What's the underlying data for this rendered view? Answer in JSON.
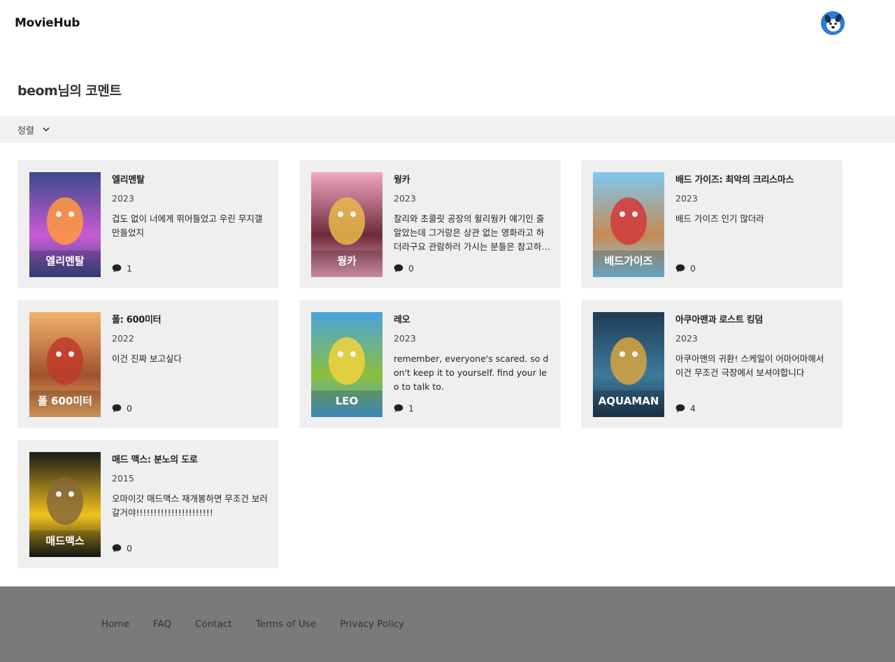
{
  "header": {
    "logo": "MovieHub",
    "avatar_icon": "dog-avatar-icon"
  },
  "page": {
    "title": "beom님의 코멘트"
  },
  "sort": {
    "label": "정렬",
    "icon": "chevron-down-icon"
  },
  "comments": [
    {
      "title": "엘리멘탈",
      "year": "2023",
      "text": "겁도 없이 너에게 뛰어들었고 우린 무지갤 만들었지",
      "comment_count": "1",
      "poster_caption": "엘리멘탈",
      "poster_colors": [
        "#3a4a8a",
        "#c95bd6",
        "#ff9a3c"
      ]
    },
    {
      "title": "웡카",
      "year": "2023",
      "text": "찰리와 초콜릿 공장의 윌리웡카 얘기인 줄 알았는데 그거랑은 상관 없는 영화라고 하더라구요 관람하러 가시는 분들은 참고하세요",
      "comment_count": "0",
      "poster_caption": "웡카",
      "poster_colors": [
        "#f2a7c3",
        "#6b2a3a",
        "#e8b84a"
      ]
    },
    {
      "title": "배드 가이즈: 최악의 크리스마스",
      "year": "2023",
      "text": "배드 가이즈 인기 많더라",
      "comment_count": "0",
      "poster_caption": "배드가이즈",
      "poster_colors": [
        "#7fc8f0",
        "#c58b54",
        "#d23b3b"
      ]
    },
    {
      "title": "폴: 600미터",
      "year": "2022",
      "text": "이건 진짜 보고싶다",
      "comment_count": "0",
      "poster_caption": "폴 600미터",
      "poster_colors": [
        "#f4b26b",
        "#a0522d",
        "#c0392b"
      ]
    },
    {
      "title": "레오",
      "year": "2023",
      "text": "remember, everyone's scared. so don't keep it to yourself. find your leo to talk to.",
      "comment_count": "1",
      "poster_caption": "LEO",
      "poster_colors": [
        "#4aa3df",
        "#8bbf3c",
        "#f2d23c"
      ]
    },
    {
      "title": "아쿠아맨과 로스트 킹덤",
      "year": "2023",
      "text": "아쿠아맨의 귀환! 스케일이 어마어마해서 이건 무조건 극장에서 보셔야합니다",
      "comment_count": "4",
      "poster_caption": "AQUAMAN",
      "poster_colors": [
        "#1f3b55",
        "#3d7a9b",
        "#d9a441"
      ]
    },
    {
      "title": "매드 맥스: 분노의 도로",
      "year": "2015",
      "text": "오마이갓 매드맥스 재개봉하면 무조건 보러갈거야!!!!!!!!!!!!!!!!!!!!!!",
      "comment_count": "0",
      "poster_caption": "매드맥스",
      "poster_colors": [
        "#1a1a1a",
        "#f2c21b",
        "#8a6a3a"
      ]
    }
  ],
  "footer": {
    "links": [
      "Home",
      "FAQ",
      "Contact",
      "Terms of Use",
      "Privacy Policy"
    ]
  }
}
